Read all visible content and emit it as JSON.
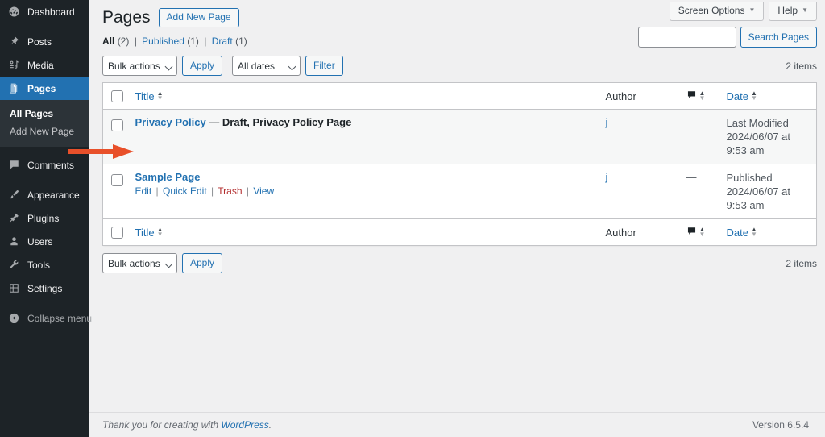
{
  "sidebar": {
    "items": [
      {
        "label": "Dashboard",
        "icon": "dashboard-icon",
        "state": "normal"
      },
      {
        "label": "Posts",
        "icon": "pin-icon",
        "state": "normal"
      },
      {
        "label": "Media",
        "icon": "media-icon",
        "state": "normal"
      },
      {
        "label": "Pages",
        "icon": "pages-icon",
        "state": "current"
      },
      {
        "label": "Comments",
        "icon": "comment-icon",
        "state": "normal"
      },
      {
        "label": "Appearance",
        "icon": "brush-icon",
        "state": "normal"
      },
      {
        "label": "Plugins",
        "icon": "plugin-icon",
        "state": "normal"
      },
      {
        "label": "Users",
        "icon": "user-icon",
        "state": "normal"
      },
      {
        "label": "Tools",
        "icon": "wrench-icon",
        "state": "normal"
      },
      {
        "label": "Settings",
        "icon": "settings-icon",
        "state": "normal"
      },
      {
        "label": "Collapse menu",
        "icon": "collapse-icon",
        "state": "dim"
      }
    ],
    "submenu": [
      {
        "label": "All Pages",
        "current": true
      },
      {
        "label": "Add New Page",
        "current": false
      }
    ]
  },
  "header": {
    "screen_options": "Screen Options",
    "help": "Help",
    "caret": "▼"
  },
  "search": {
    "value": "",
    "placeholder": "",
    "button_label": "Search Pages"
  },
  "page": {
    "title": "Pages",
    "add_new_label": "Add New Page"
  },
  "views": {
    "all_label": "All",
    "all_count": "(2)",
    "published_label": "Published",
    "published_count": "(1)",
    "draft_label": "Draft",
    "draft_count": "(1)",
    "separator": "|"
  },
  "tablenav_top": {
    "bulk_actions": "Bulk actions",
    "apply": "Apply",
    "dates": "All dates",
    "filter": "Filter",
    "items_count": "2 items"
  },
  "tablenav_bottom": {
    "bulk_actions": "Bulk actions",
    "apply": "Apply",
    "items_count": "2 items"
  },
  "table": {
    "columns": {
      "title": "Title",
      "author": "Author",
      "comments": "💬",
      "date": "Date"
    },
    "rows": [
      {
        "title": "Privacy Policy",
        "state": "— Draft, Privacy Policy Page",
        "author": "j",
        "comments": "—",
        "date_status": "Last Modified",
        "date_value": "2024/06/07 at 9:53 am",
        "actions": []
      },
      {
        "title": "Sample Page",
        "state": "",
        "author": "j",
        "comments": "—",
        "date_status": "Published",
        "date_value": "2024/06/07 at 9:53 am",
        "actions": [
          {
            "label": "Edit",
            "kind": "edit"
          },
          {
            "label": "Quick Edit",
            "kind": "quick-edit"
          },
          {
            "label": "Trash",
            "kind": "trash"
          },
          {
            "label": "View",
            "kind": "view"
          }
        ]
      }
    ]
  },
  "footer": {
    "thanks_text": "Thank you for creating with ",
    "link": "WordPress",
    "thanks_suffix": ".",
    "version": "Version 6.5.4"
  },
  "annotation": {
    "arrow_color": "#e8502a",
    "points_at": "Edit"
  },
  "colors": {
    "sidebar_bg": "#1d2327",
    "submenu_bg": "#2c3338",
    "accent_blue": "#2271b1",
    "page_bg": "#f0f0f1",
    "trash_red": "#b32d2e",
    "arrow_red": "#e8502a"
  }
}
